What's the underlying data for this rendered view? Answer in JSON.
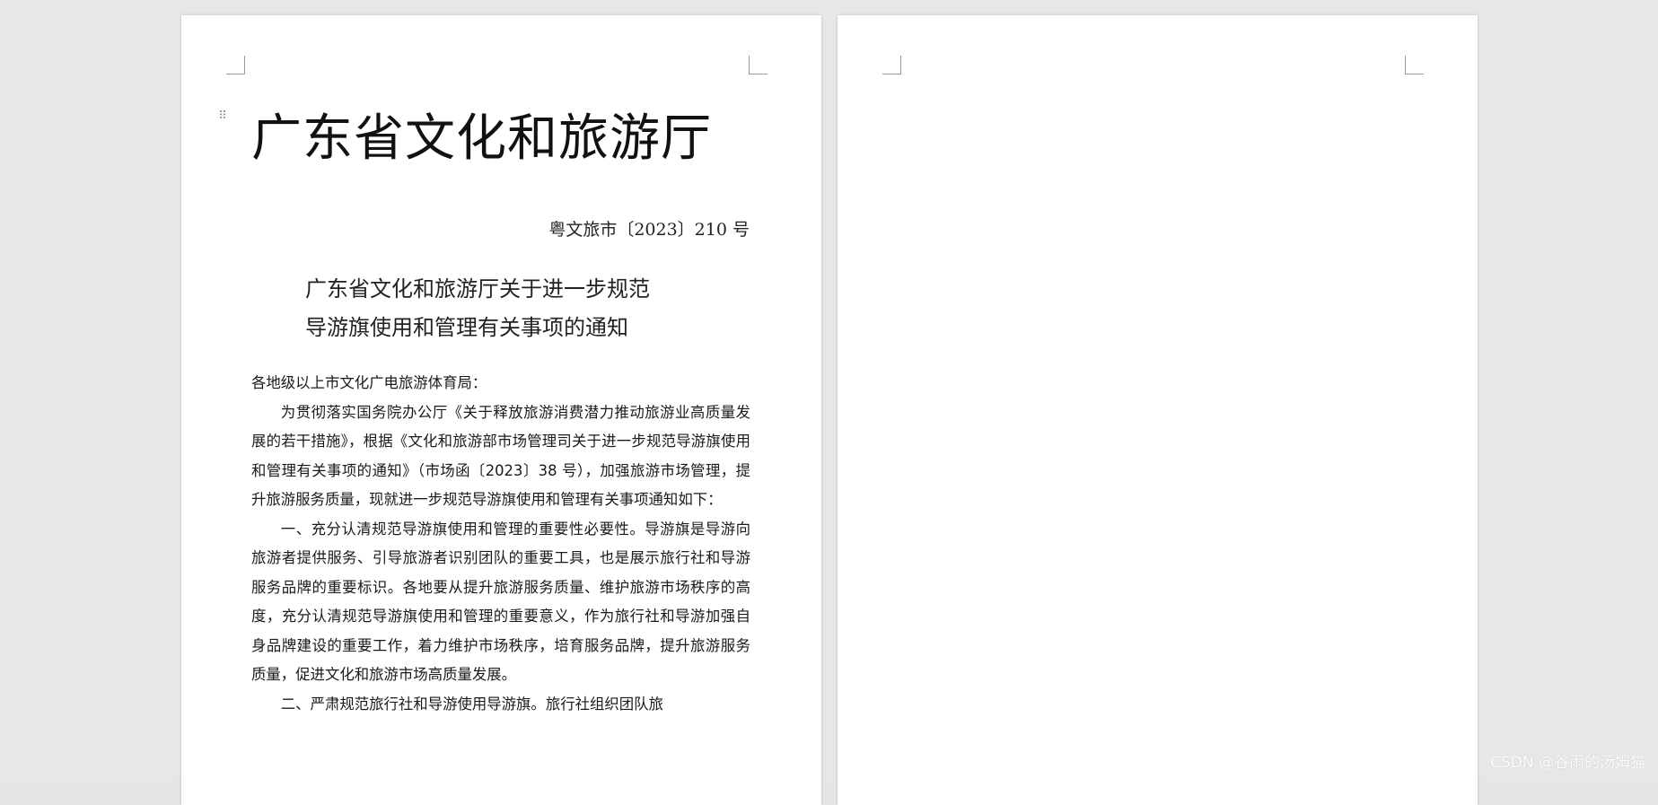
{
  "document": {
    "org_title": "广东省文化和旅游厅",
    "doc_number": "粤文旅市〔2023〕210 号",
    "heading_lines": [
      "广东省文化和旅游厅关于进一步规范",
      "导游旗使用和管理有关事项的通知"
    ],
    "addressee": "各地级以上市文化广电旅游体育局：",
    "paragraphs": [
      "为贯彻落实国务院办公厅《关于释放旅游消费潜力推动旅游业高质量发展的若干措施》，根据《文化和旅游部市场管理司关于进一步规范导游旗使用和管理有关事项的通知》（市场函〔2023〕38 号），加强旅游市场管理，提升旅游服务质量，现就进一步规范导游旗使用和管理有关事项通知如下：",
      "一、充分认清规范导游旗使用和管理的重要性必要性。导游旗是导游向旅游者提供服务、引导旅游者识别团队的重要工具，也是展示旅行社和导游服务品牌的重要标识。各地要从提升旅游服务质量、维护旅游市场秩序的高度，充分认清规范导游旗使用和管理的重要意义，作为旅行社和导游加强自身品牌建设的重要工作，着力维护市场秩序，培育服务品牌，提升旅游服务质量，促进文化和旅游市场高质量发展。",
      "二、严肃规范旅行社和导游使用导游旗。旅行社组织团队旅"
    ]
  },
  "icons": {
    "move_handle": "move-handle-icon"
  },
  "watermark": "CSDN @谷雨的汤姆猫"
}
